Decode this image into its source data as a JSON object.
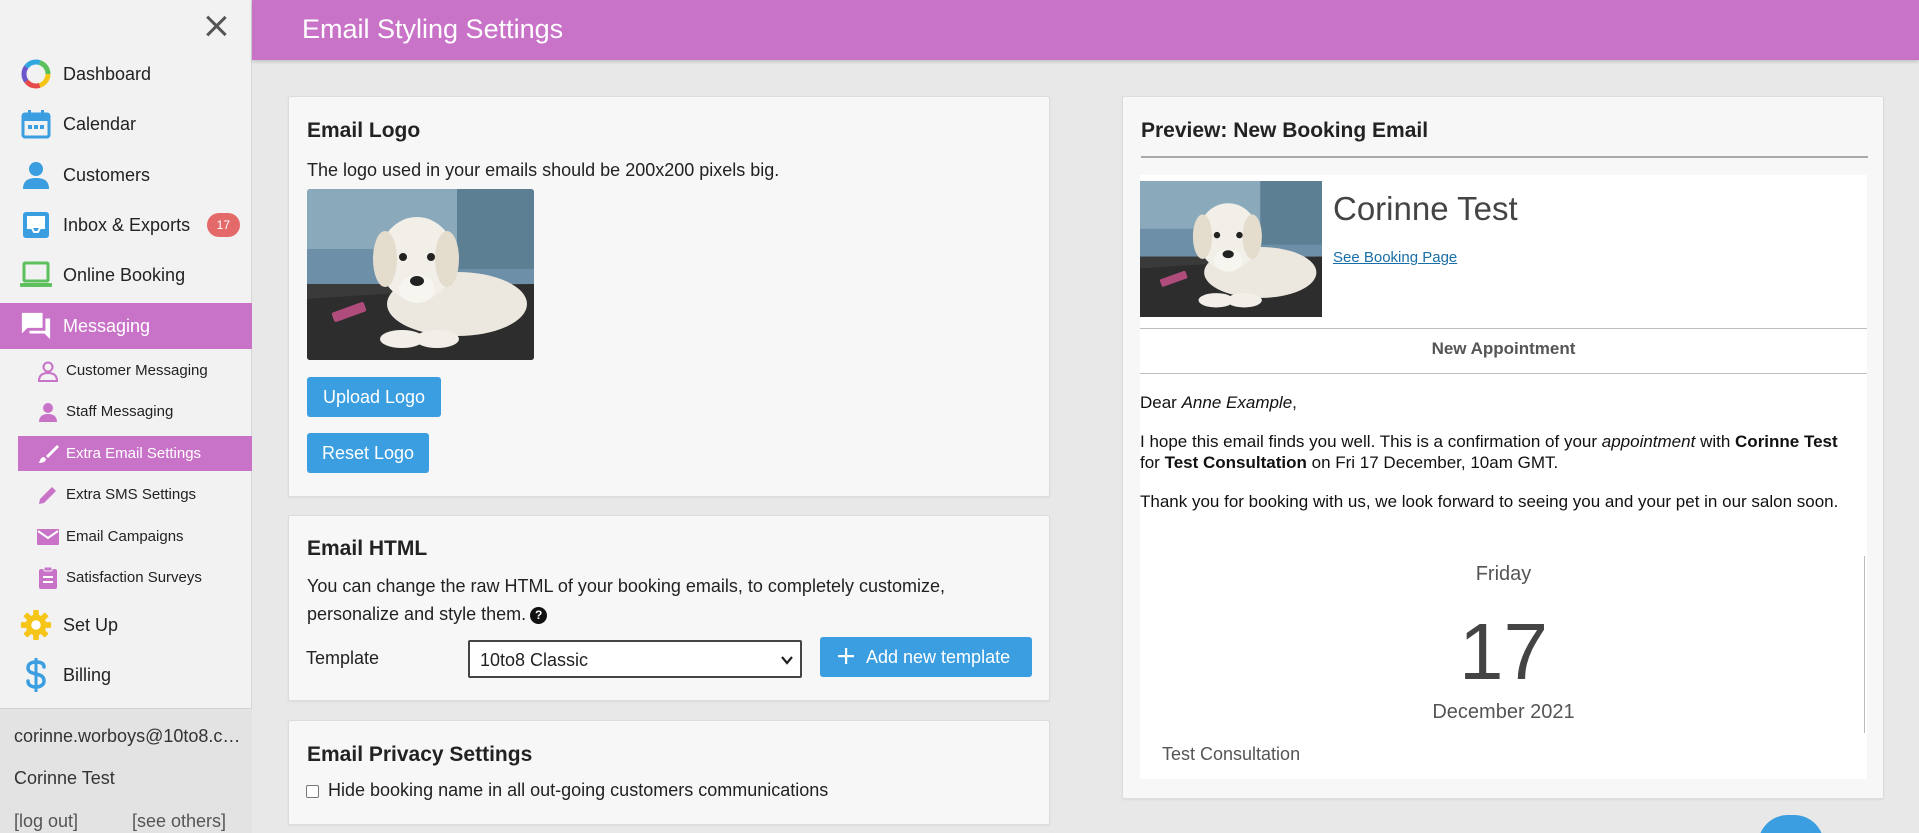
{
  "header": {
    "title": "Email Styling Settings"
  },
  "sidebar": {
    "items": [
      {
        "label": "Dashboard",
        "icon": "dashboard-ring-icon"
      },
      {
        "label": "Calendar",
        "icon": "calendar-icon"
      },
      {
        "label": "Customers",
        "icon": "person-icon"
      },
      {
        "label": "Inbox & Exports",
        "icon": "inbox-icon",
        "badge": "17"
      },
      {
        "label": "Online Booking",
        "icon": "laptop-icon"
      },
      {
        "label": "Messaging",
        "icon": "chat-icon",
        "active": true
      },
      {
        "label": "Set Up",
        "icon": "gear-icon"
      },
      {
        "label": "Billing",
        "icon": "dollar-icon"
      }
    ],
    "subitems": [
      {
        "label": "Customer Messaging",
        "icon": "person-outline-icon"
      },
      {
        "label": "Staff Messaging",
        "icon": "person-icon"
      },
      {
        "label": "Extra Email Settings",
        "icon": "brush-icon",
        "active": true
      },
      {
        "label": "Extra SMS Settings",
        "icon": "pencil-icon"
      },
      {
        "label": "Email Campaigns",
        "icon": "mail-icon"
      },
      {
        "label": "Satisfaction Surveys",
        "icon": "clipboard-icon"
      }
    ]
  },
  "account": {
    "email": "corinne.worboys@10to8.com",
    "name": "Corinne Test",
    "logout": "[log out]",
    "see_others": "[see others]"
  },
  "email_logo": {
    "title": "Email Logo",
    "description": "The logo used in your emails should be 200x200 pixels big.",
    "upload_label": "Upload Logo",
    "reset_label": "Reset Logo"
  },
  "email_html": {
    "title": "Email HTML",
    "description": "You can change the raw HTML of your booking emails, to completely customize, personalize and style them.",
    "template_label": "Template",
    "template_value": "10to8 Classic",
    "add_template_label": "Add new template"
  },
  "privacy": {
    "title": "Email Privacy Settings",
    "checkbox_label": "Hide booking name in all out-going customers communications",
    "checked": false
  },
  "preview": {
    "title": "Preview: New Booking Email",
    "business_name": "Corinne Test",
    "link_text": "See Booking Page",
    "section_title": "New Appointment",
    "dear": "Dear",
    "customer_name": "Anne Example",
    "line1_a": "I hope this email finds you well. This is a confirmation of your",
    "line1_appt": "appointment",
    "line1_with": "with",
    "staff": "Corinne Test",
    "line1_for": "for",
    "service_bold": "Test Consultation",
    "line1_on": "on Fri 17 December, 10am GMT.",
    "line2": "Thank you for booking with us, we look forward to seeing you and your pet in our salon soon.",
    "day_name": "Friday",
    "day_number": "17",
    "month_year": "December 2021",
    "service": "Test Consultation"
  },
  "colors": {
    "accent": "#c872c8",
    "button": "#3a9ee0",
    "badge": "#e46a6a"
  }
}
